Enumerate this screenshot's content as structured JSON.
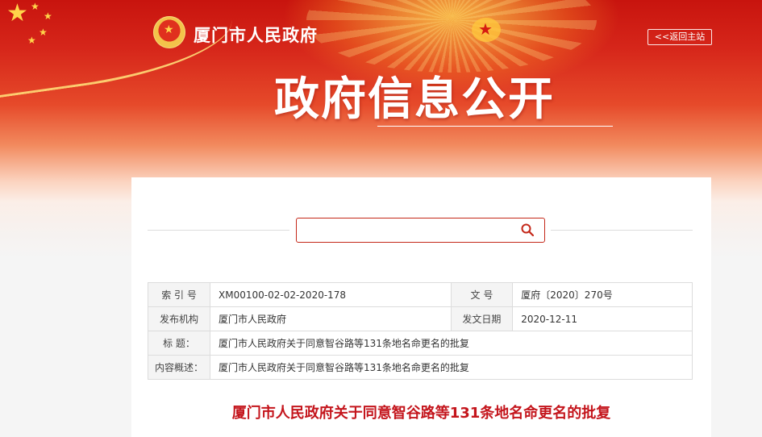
{
  "header": {
    "site_name": "厦门市人民政府",
    "back_link": "<<返回主站",
    "section_title": "政府信息公开"
  },
  "search": {
    "value": "",
    "placeholder": ""
  },
  "meta_table": {
    "index_label": "索 引 号",
    "index_value": "XM00100-02-02-2020-178",
    "doc_no_label": "文  号",
    "doc_no_value": "厦府〔2020〕270号",
    "issuer_label": "发布机构",
    "issuer_value": "厦门市人民政府",
    "date_label": "发文日期",
    "date_value": "2020-12-11",
    "title_label": "标    题：",
    "title_value": "厦门市人民政府关于同意智谷路等131条地名命更名的批复",
    "summary_label": "内容概述：",
    "summary_value": "厦门市人民政府关于同意智谷路等131条地名命更名的批复"
  },
  "document": {
    "title": "厦门市人民政府关于同意智谷路等131条地名命更名的批复"
  },
  "colors": {
    "banner_red": "#d6261a",
    "accent_red": "#c4151c",
    "gold": "#ffd54a"
  },
  "icons": {
    "search": "magnifier",
    "emblem": "national-emblem",
    "stars": "five-pointed-star"
  }
}
